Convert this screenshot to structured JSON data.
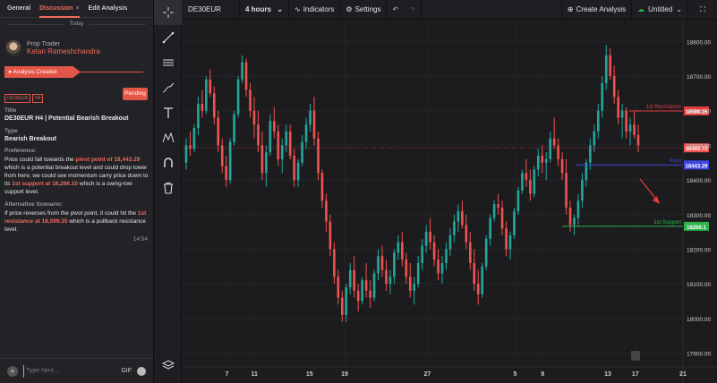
{
  "left_panel": {
    "tabs": [
      {
        "label": "General"
      },
      {
        "label": "Discussion",
        "close": "×"
      },
      {
        "label": "Edit Analysis"
      }
    ],
    "today_label": "Today",
    "author": {
      "role": "Prop Trader",
      "name": "Ketan Rameshchandra"
    },
    "status": "Analysis Created",
    "tags": [
      "DE30EUR",
      "H4"
    ],
    "pending_label": "Pending",
    "title_label": "Title",
    "title_value": "DE30EUR H4 | Potential Bearish Breakout",
    "type_label": "Type",
    "type_value": "Bearish Breakout",
    "preference_label": "Preference:",
    "preference": {
      "t1": "Price could fall towards the ",
      "h1": "pivot point of 18,443.29",
      "t2": " which is a potential breakout level and could drop lower from here; we could see momentum carry price down to its ",
      "h2": "1st support at 18,266.10",
      "t3": " which is a swing-low support level."
    },
    "alternative_label": "Alternative Scenario:",
    "alternative": {
      "t1": "If price reverses from the pivot point, it could hit the ",
      "h1": "1st resistance at 18,599.35",
      "t2": " which is a pullback resistance level."
    },
    "time": "14:54",
    "message_placeholder": "Type here...",
    "gif_label": "GIF"
  },
  "topbar": {
    "symbol": "DE30EUR",
    "timeframe": "4 hours",
    "indicators": "Indicators",
    "settings": "Settings",
    "create_analysis": "Create Analysis",
    "layout_name": "Untitled"
  },
  "chart_data": {
    "type": "candlestick",
    "y_ticks": [
      "18800.00",
      "18700.00",
      "18600.00",
      "18500.00",
      "18400.00",
      "18300.00",
      "18200.00",
      "18100.00",
      "18000.00",
      "17900.00"
    ],
    "x_ticks": [
      "7",
      "11",
      "15",
      "19",
      "27",
      "5",
      "9",
      "13",
      "17",
      "21"
    ],
    "ylim": [
      17860,
      18850
    ],
    "levels": [
      {
        "name": "1st Resistance",
        "value": 18599.35,
        "label": "18599.35",
        "color": "#e23b3b"
      },
      {
        "name": "Pivot",
        "value": 18443.29,
        "label": "18443.29",
        "color": "#3d46e0"
      },
      {
        "name": "1st Support",
        "value": 18266.1,
        "label": "18266.1",
        "color": "#2fb34a"
      }
    ],
    "current_price": {
      "label": "18492.72",
      "value": 18492.72
    },
    "candle_colors": {
      "up": "#26a69a",
      "down": "#ef5350"
    },
    "candles": [
      [
        18450,
        18520,
        18430,
        18500
      ],
      [
        18500,
        18540,
        18470,
        18490
      ],
      [
        18490,
        18560,
        18480,
        18550
      ],
      [
        18550,
        18640,
        18530,
        18620
      ],
      [
        18620,
        18660,
        18580,
        18600
      ],
      [
        18600,
        18700,
        18590,
        18690
      ],
      [
        18690,
        18720,
        18640,
        18650
      ],
      [
        18650,
        18670,
        18560,
        18580
      ],
      [
        18580,
        18600,
        18480,
        18500
      ],
      [
        18500,
        18520,
        18420,
        18440
      ],
      [
        18440,
        18470,
        18380,
        18400
      ],
      [
        18400,
        18520,
        18390,
        18510
      ],
      [
        18510,
        18600,
        18500,
        18590
      ],
      [
        18590,
        18700,
        18580,
        18690
      ],
      [
        18690,
        18760,
        18680,
        18740
      ],
      [
        18740,
        18750,
        18640,
        18660
      ],
      [
        18660,
        18680,
        18580,
        18600
      ],
      [
        18600,
        18640,
        18520,
        18560
      ],
      [
        18560,
        18600,
        18480,
        18500
      ],
      [
        18500,
        18540,
        18400,
        18420
      ],
      [
        18420,
        18500,
        18380,
        18480
      ],
      [
        18480,
        18590,
        18470,
        18570
      ],
      [
        18570,
        18610,
        18520,
        18540
      ],
      [
        18540,
        18560,
        18440,
        18460
      ],
      [
        18460,
        18520,
        18420,
        18500
      ],
      [
        18500,
        18560,
        18480,
        18540
      ],
      [
        18540,
        18560,
        18460,
        18470
      ],
      [
        18470,
        18490,
        18380,
        18400
      ],
      [
        18400,
        18460,
        18380,
        18450
      ],
      [
        18450,
        18530,
        18440,
        18510
      ],
      [
        18510,
        18580,
        18490,
        18560
      ],
      [
        18560,
        18620,
        18540,
        18600
      ],
      [
        18600,
        18640,
        18500,
        18520
      ],
      [
        18520,
        18540,
        18400,
        18420
      ],
      [
        18420,
        18430,
        18320,
        18340
      ],
      [
        18340,
        18360,
        18250,
        18280
      ],
      [
        18280,
        18300,
        18180,
        18200
      ],
      [
        18200,
        18220,
        18100,
        18120
      ],
      [
        18120,
        18140,
        18040,
        18060
      ],
      [
        18060,
        18080,
        17990,
        18010
      ],
      [
        18010,
        18100,
        17990,
        18090
      ],
      [
        18090,
        18160,
        18070,
        18140
      ],
      [
        18140,
        18180,
        18060,
        18080
      ],
      [
        18080,
        18100,
        18020,
        18050
      ],
      [
        18050,
        18120,
        18040,
        18110
      ],
      [
        18110,
        18160,
        18060,
        18080
      ],
      [
        18080,
        18110,
        18030,
        18060
      ],
      [
        18060,
        18140,
        18050,
        18130
      ],
      [
        18130,
        18200,
        18110,
        18180
      ],
      [
        18180,
        18210,
        18120,
        18140
      ],
      [
        18140,
        18170,
        18080,
        18100
      ],
      [
        18100,
        18140,
        18070,
        18120
      ],
      [
        18120,
        18200,
        18100,
        18190
      ],
      [
        18190,
        18240,
        18170,
        18220
      ],
      [
        18220,
        18250,
        18150,
        18170
      ],
      [
        18170,
        18190,
        18100,
        18120
      ],
      [
        18120,
        18160,
        18060,
        18080
      ],
      [
        18080,
        18120,
        18040,
        18100
      ],
      [
        18100,
        18180,
        18090,
        18160
      ],
      [
        18160,
        18230,
        18140,
        18210
      ],
      [
        18210,
        18270,
        18190,
        18250
      ],
      [
        18250,
        18290,
        18200,
        18220
      ],
      [
        18220,
        18240,
        18150,
        18170
      ],
      [
        18170,
        18200,
        18110,
        18130
      ],
      [
        18130,
        18180,
        18100,
        18160
      ],
      [
        18160,
        18220,
        18140,
        18200
      ],
      [
        18200,
        18260,
        18180,
        18240
      ],
      [
        18240,
        18300,
        18220,
        18280
      ],
      [
        18280,
        18330,
        18250,
        18310
      ],
      [
        18310,
        18340,
        18260,
        18270
      ],
      [
        18270,
        18300,
        18200,
        18220
      ],
      [
        18220,
        18250,
        18140,
        18160
      ],
      [
        18160,
        18200,
        18080,
        18100
      ],
      [
        18100,
        18140,
        18040,
        18070
      ],
      [
        18070,
        18160,
        18060,
        18150
      ],
      [
        18150,
        18240,
        18140,
        18230
      ],
      [
        18230,
        18300,
        18210,
        18290
      ],
      [
        18290,
        18340,
        18280,
        18330
      ],
      [
        18330,
        18360,
        18300,
        18320
      ],
      [
        18320,
        18340,
        18240,
        18260
      ],
      [
        18260,
        18280,
        18180,
        18200
      ],
      [
        18200,
        18250,
        18170,
        18240
      ],
      [
        18240,
        18320,
        18230,
        18310
      ],
      [
        18310,
        18380,
        18300,
        18370
      ],
      [
        18370,
        18430,
        18360,
        18420
      ],
      [
        18420,
        18460,
        18380,
        18400
      ],
      [
        18400,
        18430,
        18340,
        18360
      ],
      [
        18360,
        18440,
        18350,
        18430
      ],
      [
        18430,
        18490,
        18410,
        18470
      ],
      [
        18470,
        18500,
        18420,
        18450
      ],
      [
        18450,
        18480,
        18400,
        18460
      ],
      [
        18460,
        18540,
        18450,
        18520
      ],
      [
        18520,
        18580,
        18490,
        18500
      ],
      [
        18500,
        18520,
        18440,
        18460
      ],
      [
        18460,
        18480,
        18400,
        18420
      ],
      [
        18420,
        18460,
        18300,
        18320
      ],
      [
        18320,
        18340,
        18250,
        18270
      ],
      [
        18270,
        18300,
        18240,
        18290
      ],
      [
        18290,
        18360,
        18270,
        18340
      ],
      [
        18340,
        18420,
        18320,
        18400
      ],
      [
        18400,
        18460,
        18380,
        18450
      ],
      [
        18450,
        18520,
        18430,
        18500
      ],
      [
        18500,
        18560,
        18480,
        18540
      ],
      [
        18540,
        18620,
        18520,
        18600
      ],
      [
        18600,
        18700,
        18580,
        18680
      ],
      [
        18680,
        18790,
        18660,
        18760
      ],
      [
        18760,
        18780,
        18690,
        18700
      ],
      [
        18700,
        18730,
        18620,
        18640
      ],
      [
        18640,
        18660,
        18560,
        18580
      ],
      [
        18580,
        18620,
        18520,
        18600
      ],
      [
        18600,
        18610,
        18520,
        18540
      ],
      [
        18540,
        18580,
        18500,
        18560
      ],
      [
        18560,
        18600,
        18520,
        18530
      ],
      [
        18530,
        18560,
        18480,
        18500
      ]
    ]
  }
}
